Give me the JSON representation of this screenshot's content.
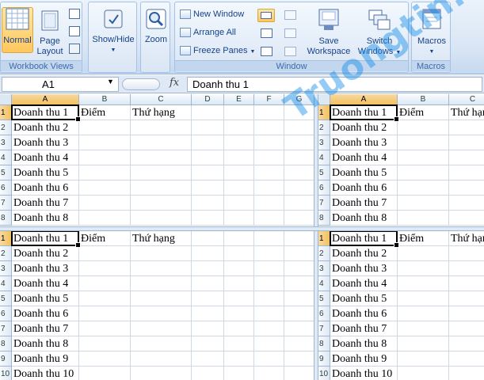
{
  "ribbon": {
    "workbook_views": {
      "label": "Workbook Views",
      "normal": "Normal",
      "page_layout_1": "Page",
      "page_layout_2": "Layout"
    },
    "show_hide": "Show/Hide",
    "zoom": "Zoom",
    "window": {
      "label": "Window",
      "new_window": "New Window",
      "arrange_all": "Arrange All",
      "freeze_panes": "Freeze Panes",
      "save_workspace_1": "Save",
      "save_workspace_2": "Workspace",
      "switch_windows_1": "Switch",
      "switch_windows_2": "Windows"
    },
    "macros": {
      "label": "Macros",
      "button": "Macros"
    }
  },
  "formula_bar": {
    "name_box": "A1",
    "fx": "fx",
    "content": "Doanh thu 1"
  },
  "columns_left": [
    "A",
    "B",
    "C",
    "D",
    "E",
    "F",
    "G"
  ],
  "columns_right": [
    "A",
    "B",
    "C"
  ],
  "rows_top": [
    "1",
    "2",
    "3",
    "4",
    "5",
    "6",
    "7",
    "8"
  ],
  "rows_bottom": [
    "1",
    "2",
    "3",
    "4",
    "5",
    "6",
    "7",
    "8",
    "9",
    "10"
  ],
  "cells": {
    "a": [
      "Doanh thu 1",
      "Doanh thu 2",
      "Doanh thu 3",
      "Doanh thu 4",
      "Doanh thu 5",
      "Doanh thu 6",
      "Doanh thu 7",
      "Doanh thu 8",
      "Doanh thu 9",
      "Doanh thu 10"
    ],
    "b1": "Điểm",
    "c1": "Thứ hạng"
  },
  "watermark": "Truongtin.top",
  "colors": {
    "ribbon_text": "#15428b",
    "selected_header": "#f1c15f",
    "gridline": "#d0d7e5"
  }
}
